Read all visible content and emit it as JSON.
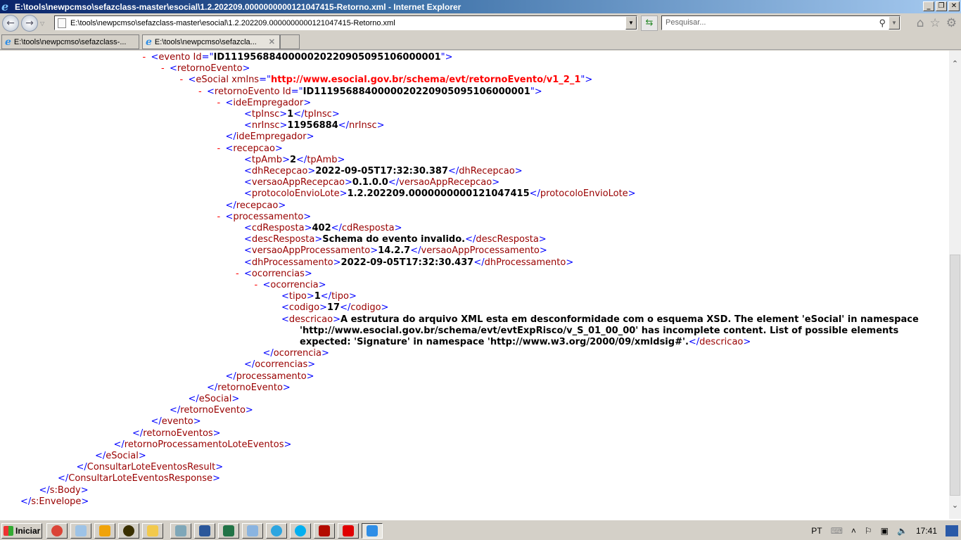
{
  "window": {
    "title": "E:\\tools\\newpcmso\\sefazclass-master\\esocial\\1.2.202209.0000000000121047415-Retorno.xml - Internet Explorer"
  },
  "address": {
    "value": "E:\\tools\\newpcmso\\sefazclass-master\\esocial\\1.2.202209.0000000000121047415-Retorno.xml"
  },
  "search": {
    "placeholder": "Pesquisar..."
  },
  "tabs": [
    {
      "label": "E:\\tools\\newpcmso\\sefazclass-..."
    },
    {
      "label": "E:\\tools\\newpcmso\\sefazcla..."
    }
  ],
  "xml": [
    {
      "d": 7,
      "k": "open",
      "tag": "evento",
      "attrs": [
        {
          "n": "Id",
          "v": "ID1119568840000020220905095106000001"
        }
      ]
    },
    {
      "d": 8,
      "k": "open",
      "tag": "retornoEvento"
    },
    {
      "d": 9,
      "k": "open",
      "tag": "eSocial",
      "attrs": [
        {
          "n": "xmlns",
          "v": "http://www.esocial.gov.br/schema/evt/retornoEvento/v1_2_1",
          "ns": true
        }
      ]
    },
    {
      "d": 10,
      "k": "open",
      "tag": "retornoEvento",
      "attrs": [
        {
          "n": "Id",
          "v": "ID1119568840000020220905095106000001"
        }
      ]
    },
    {
      "d": 11,
      "k": "open",
      "tag": "ideEmpregador"
    },
    {
      "d": 12,
      "k": "leaf",
      "tag": "tpInsc",
      "text": "1"
    },
    {
      "d": 12,
      "k": "leaf",
      "tag": "nrInsc",
      "text": "11956884"
    },
    {
      "d": 11,
      "k": "close",
      "tag": "ideEmpregador"
    },
    {
      "d": 11,
      "k": "open",
      "tag": "recepcao"
    },
    {
      "d": 12,
      "k": "leaf",
      "tag": "tpAmb",
      "text": "2"
    },
    {
      "d": 12,
      "k": "leaf",
      "tag": "dhRecepcao",
      "text": "2022-09-05T17:32:30.387"
    },
    {
      "d": 12,
      "k": "leaf",
      "tag": "versaoAppRecepcao",
      "text": "0.1.0.0"
    },
    {
      "d": 12,
      "k": "leaf",
      "tag": "protocoloEnvioLote",
      "text": "1.2.202209.0000000000121047415"
    },
    {
      "d": 11,
      "k": "close",
      "tag": "recepcao"
    },
    {
      "d": 11,
      "k": "open",
      "tag": "processamento"
    },
    {
      "d": 12,
      "k": "leaf",
      "tag": "cdResposta",
      "text": "402"
    },
    {
      "d": 12,
      "k": "leaf",
      "tag": "descResposta",
      "text": "Schema do evento invalido."
    },
    {
      "d": 12,
      "k": "leaf",
      "tag": "versaoAppProcessamento",
      "text": "14.2.7"
    },
    {
      "d": 12,
      "k": "leaf",
      "tag": "dhProcessamento",
      "text": "2022-09-05T17:32:30.437"
    },
    {
      "d": 12,
      "k": "open",
      "tag": "ocorrencias"
    },
    {
      "d": 13,
      "k": "open",
      "tag": "ocorrencia"
    },
    {
      "d": 14,
      "k": "leaf",
      "tag": "tipo",
      "text": "1"
    },
    {
      "d": 14,
      "k": "leaf",
      "tag": "codigo",
      "text": "17"
    },
    {
      "d": 14,
      "k": "leaf",
      "tag": "descricao",
      "wrap": true,
      "rows": 3,
      "text": "A estrutura do arquivo XML esta em desconformidade com o esquema XSD. The element 'eSocial' in namespace 'http://www.esocial.gov.br/schema/evt/evtExpRisco/v_S_01_00_00' has incomplete content. List of possible elements expected: 'Signature' in namespace 'http://www.w3.org/2000/09/xmldsig#'."
    },
    {
      "d": 13,
      "k": "close",
      "tag": "ocorrencia"
    },
    {
      "d": 12,
      "k": "close",
      "tag": "ocorrencias"
    },
    {
      "d": 11,
      "k": "close",
      "tag": "processamento"
    },
    {
      "d": 10,
      "k": "close",
      "tag": "retornoEvento"
    },
    {
      "d": 9,
      "k": "close",
      "tag": "eSocial"
    },
    {
      "d": 8,
      "k": "close",
      "tag": "retornoEvento"
    },
    {
      "d": 7,
      "k": "close",
      "tag": "evento"
    },
    {
      "d": 6,
      "k": "close",
      "tag": "retornoEventos"
    },
    {
      "d": 5,
      "k": "close",
      "tag": "retornoProcessamentoLoteEventos"
    },
    {
      "d": 4,
      "k": "close",
      "tag": "eSocial"
    },
    {
      "d": 3,
      "k": "close",
      "tag": "ConsultarLoteEventosResult"
    },
    {
      "d": 2,
      "k": "close",
      "tag": "ConsultarLoteEventosResponse"
    },
    {
      "d": 1,
      "k": "close",
      "tag": "s:Body"
    },
    {
      "d": 0,
      "k": "close",
      "tag": "s:Envelope"
    }
  ],
  "taskbar": {
    "start_label": "Iniciar",
    "apps": [
      {
        "name": "chrome",
        "color": "#db4437"
      },
      {
        "name": "notepad",
        "color": "#9ec3e6"
      },
      {
        "name": "outlook",
        "color": "#f0a30a"
      },
      {
        "name": "ultraedit",
        "color": "#3a3000"
      },
      {
        "name": "explorer",
        "color": "#f2c94c"
      },
      {
        "name": "app",
        "color": "#7fa7b8"
      },
      {
        "name": "word",
        "color": "#2b579a"
      },
      {
        "name": "excel",
        "color": "#217346"
      },
      {
        "name": "calculator",
        "color": "#8ab4e0"
      },
      {
        "name": "telegram",
        "color": "#2ca5e0"
      },
      {
        "name": "skype",
        "color": "#00aff0"
      },
      {
        "name": "acrobat",
        "color": "#b30b00"
      },
      {
        "name": "filezilla",
        "color": "#e00000"
      },
      {
        "name": "internet-explorer",
        "color": "#2f8ee6",
        "active": true
      }
    ]
  },
  "tray": {
    "lang": "PT",
    "time": "17:41"
  }
}
